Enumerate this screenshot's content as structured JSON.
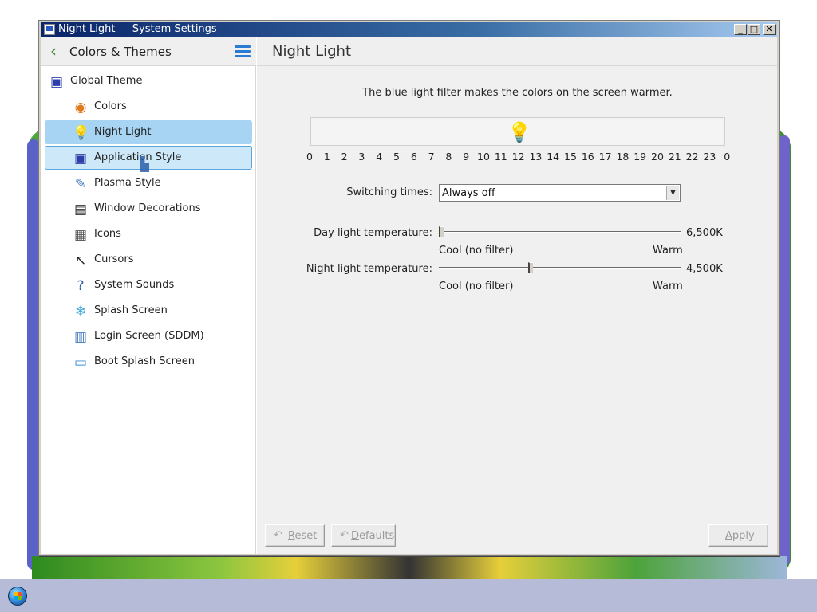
{
  "window": {
    "title": "Night Light — System Settings",
    "controls": {
      "minimize": "_",
      "maximize": "□",
      "close": "✕"
    }
  },
  "sidebar": {
    "back_label": "Colors & Themes",
    "items": [
      {
        "label": "Global Theme",
        "icon": "global-theme-icon",
        "glyph": "▣",
        "color": "#2c3fa8"
      },
      {
        "label": "Colors",
        "icon": "colors-icon",
        "glyph": "◉",
        "color": "#e07a1f"
      },
      {
        "label": "Night Light",
        "icon": "bulb-icon",
        "glyph": "💡",
        "color": "#f5c518"
      },
      {
        "label": "Application Style",
        "icon": "application-style-icon",
        "glyph": "▣",
        "color": "#2c3fa8"
      },
      {
        "label": "Plasma Style",
        "icon": "plasma-style-icon",
        "glyph": "✎",
        "color": "#4a7fc0"
      },
      {
        "label": "Window Decorations",
        "icon": "window-decorations-icon",
        "glyph": "▤",
        "color": "#333333"
      },
      {
        "label": "Icons",
        "icon": "icons-icon",
        "glyph": "▦",
        "color": "#555555"
      },
      {
        "label": "Cursors",
        "icon": "cursor-icon",
        "glyph": "↖",
        "color": "#222222"
      },
      {
        "label": "System Sounds",
        "icon": "system-sounds-icon",
        "glyph": "?",
        "color": "#2b5fa8"
      },
      {
        "label": "Splash Screen",
        "icon": "splash-screen-icon",
        "glyph": "❄",
        "color": "#3aa6d6"
      },
      {
        "label": "Login Screen (SDDM)",
        "icon": "login-screen-icon",
        "glyph": "▥",
        "color": "#4a7fc0"
      },
      {
        "label": "Boot Splash Screen",
        "icon": "boot-splash-icon",
        "glyph": "▭",
        "color": "#3a8fd6"
      }
    ]
  },
  "main": {
    "title": "Night Light",
    "description": "The blue light filter makes the colors on the screen warmer.",
    "hours": [
      "0",
      "1",
      "2",
      "3",
      "4",
      "5",
      "6",
      "7",
      "8",
      "9",
      "10",
      "11",
      "12",
      "13",
      "14",
      "15",
      "16",
      "17",
      "18",
      "19",
      "20",
      "21",
      "22",
      "23",
      "0"
    ],
    "switching": {
      "label": "Switching times:",
      "value": "Always off"
    },
    "day_temp": {
      "label": "Day light temperature:",
      "value": "6,500K",
      "cool": "Cool (no filter)",
      "warm": "Warm",
      "level": 0.0
    },
    "night_temp": {
      "label": "Night light temperature:",
      "value": "4,500K",
      "cool": "Cool (no filter)",
      "warm": "Warm",
      "level": 0.37
    }
  },
  "footer": {
    "reset": "Reset",
    "defaults": "Defaults",
    "apply": "Apply"
  },
  "colors": {
    "accent": "#a6d4f2",
    "hover": "#cde8f8"
  }
}
